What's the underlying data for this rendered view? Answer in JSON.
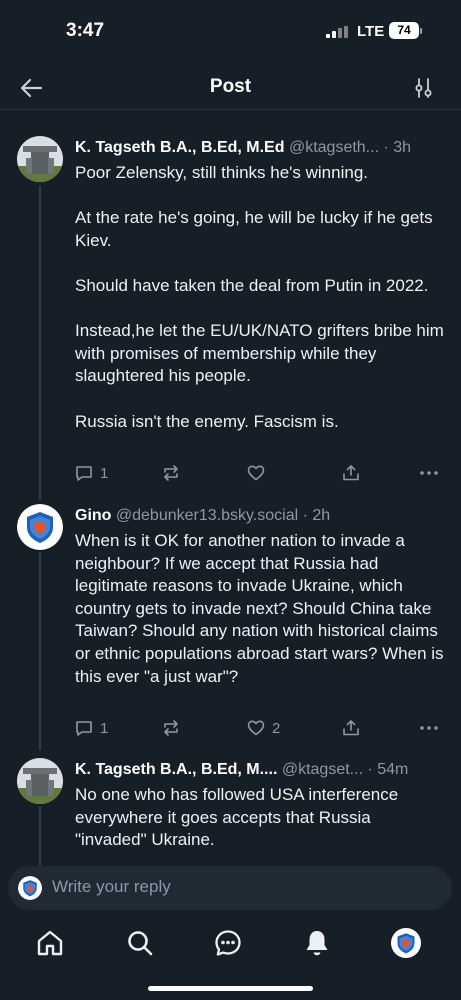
{
  "status_bar": {
    "time": "3:47",
    "network": "LTE",
    "battery": "74"
  },
  "header": {
    "title": "Post"
  },
  "posts": [
    {
      "author": "K. Tagseth B.A., B.Ed, M.Ed",
      "handle": "@ktagseth...",
      "time": "· 3h",
      "paragraphs": [
        "Poor Zelensky, still thinks he's winning.",
        "At the rate he's going, he will be lucky if he gets Kiev.",
        "Should have taken the deal from Putin in 2022.",
        "Instead,he let the EU/UK/NATO grifters bribe him with promises of membership while they slaughtered his people.",
        "Russia isn't the enemy. Fascism is."
      ],
      "reply_count": "1",
      "like_count": ""
    },
    {
      "author": "Gino",
      "handle": "@debunker13.bsky.social",
      "time": "· 2h",
      "paragraphs": [
        "When is it OK for another nation to invade a neighbour? If we accept that Russia had legitimate reasons to invade Ukraine, which country gets to invade next? Should China take Taiwan? Should any nation with historical claims or ethnic populations abroad start wars? When is this ever \"a just war\"?"
      ],
      "reply_count": "1",
      "like_count": "2"
    },
    {
      "author": "K. Tagseth B.A., B.Ed, M....",
      "handle": "@ktagset...",
      "time": "· 54m",
      "paragraphs": [
        "No one who has followed USA interference everywhere it goes accepts that Russia \"invaded\" Ukraine."
      ]
    }
  ],
  "reply_input": {
    "placeholder": "Write your reply"
  },
  "tabs": [
    "home",
    "search",
    "chat",
    "notifications",
    "profile"
  ],
  "colors": {
    "background": "#161e27",
    "muted": "#8c98a6",
    "accent": "#1185fe"
  }
}
